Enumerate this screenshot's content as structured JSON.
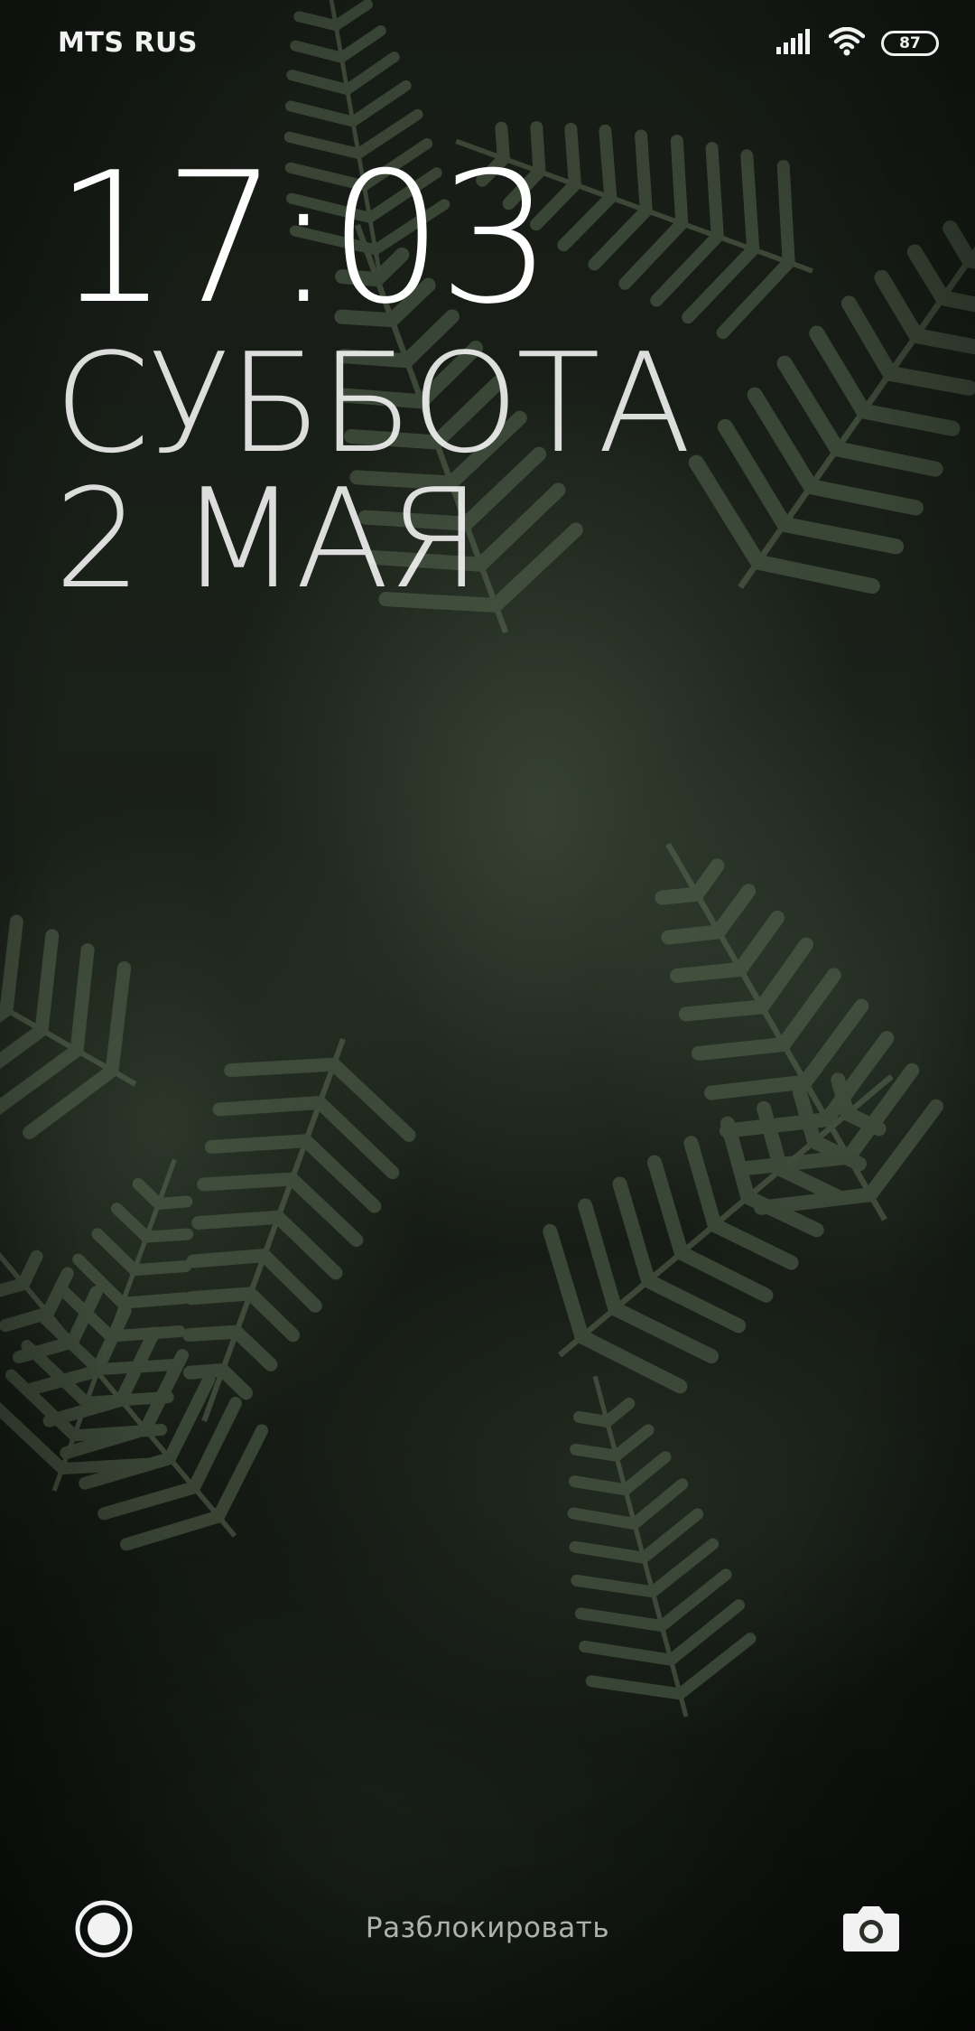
{
  "status_bar": {
    "carrier": "MTS RUS",
    "battery_level": "87",
    "icons": [
      "signal-icon",
      "wifi-icon",
      "battery-icon"
    ]
  },
  "lock_screen": {
    "time": "17:03",
    "weekday": "СУББОТА",
    "date": "2 МАЯ"
  },
  "bottom_bar": {
    "unlock_hint": "Разблокировать",
    "left_shortcut_icon": "record-icon",
    "right_shortcut_icon": "camera-icon"
  },
  "colors": {
    "text": "#ffffff",
    "wallpaper_dark": "#151b14",
    "fern_green": "#4e5c48"
  }
}
